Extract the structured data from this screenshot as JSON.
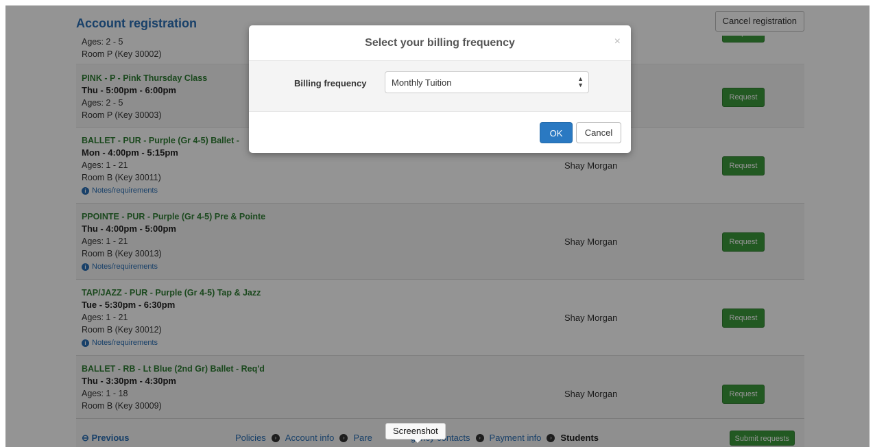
{
  "header": {
    "title": "Account registration",
    "cancel_label": "Cancel registration"
  },
  "rows": [
    {
      "name": "",
      "time": "",
      "ages": "Ages: 2 - 5",
      "room": "Room P (Key 30002)",
      "notes": "",
      "instructor": "",
      "button": "Request"
    },
    {
      "name": "PINK - P - Pink Thursday Class",
      "time": "Thu - 5:00pm - 6:00pm",
      "ages": "Ages: 2 - 5",
      "room": "Room P (Key 30003)",
      "notes": "",
      "instructor": "",
      "button": "Request"
    },
    {
      "name": "BALLET - PUR - Purple (Gr 4-5) Ballet -",
      "time": "Mon - 4:00pm - 5:15pm",
      "ages": "Ages: 1 - 21",
      "room": "Room B (Key 30011)",
      "notes": "Notes/requirements",
      "instructor": "Shay Morgan",
      "button": "Request"
    },
    {
      "name": "PPOINTE - PUR - Purple (Gr 4-5) Pre & Pointe",
      "time": "Thu - 4:00pm - 5:00pm",
      "ages": "Ages: 1 - 21",
      "room": "Room B (Key 30013)",
      "notes": "Notes/requirements",
      "instructor": "Shay Morgan",
      "button": "Request"
    },
    {
      "name": "TAP/JAZZ - PUR - Purple (Gr 4-5) Tap & Jazz",
      "time": "Tue - 5:30pm - 6:30pm",
      "ages": "Ages: 1 - 21",
      "room": "Room B (Key 30012)",
      "notes": "Notes/requirements",
      "instructor": "Shay Morgan",
      "button": "Request"
    },
    {
      "name": "BALLET - RB - Lt Blue (2nd Gr) Ballet - Req'd",
      "time": "Thu - 3:30pm - 4:30pm",
      "ages": "Ages: 1 - 18",
      "room": "Room B (Key 30009)",
      "notes": "",
      "instructor": "Shay Morgan",
      "button": "Request"
    }
  ],
  "footer": {
    "previous": "Previous",
    "steps": [
      "Policies",
      "Account info",
      "Pare",
      "gency contacts",
      "Payment info",
      "Students"
    ],
    "submit": "Submit requests"
  },
  "tooltip": "Screenshot",
  "modal": {
    "title": "Select your billing frequency",
    "close": "×",
    "field_label": "Billing frequency",
    "selected_value": "Monthly Tuition",
    "ok_label": "OK",
    "cancel_label": "Cancel"
  },
  "colors": {
    "accent_blue": "#2a6fb5",
    "class_green": "#2e7d32",
    "request_green": "#3c9a3c",
    "ok_blue": "#2a79c2"
  }
}
